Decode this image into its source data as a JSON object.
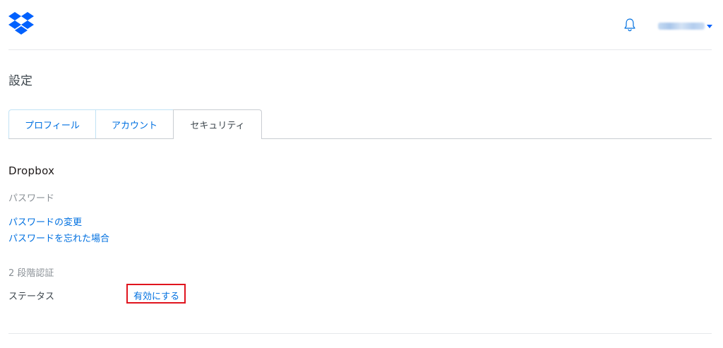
{
  "header": {
    "logo_icon": "dropbox-logo-icon",
    "notification_icon": "bell-icon",
    "user_name": "username",
    "user_menu_icon": "caret-down-icon"
  },
  "page": {
    "title": "設定"
  },
  "tabs": [
    {
      "label": "プロフィール",
      "active": false
    },
    {
      "label": "アカウント",
      "active": false
    },
    {
      "label": "セキュリティ",
      "active": true
    }
  ],
  "section": {
    "title": "Dropbox",
    "password": {
      "label": "パスワード",
      "change_link": "パスワードの変更",
      "forgot_link": "パスワードを忘れた場合"
    },
    "two_step": {
      "label": "2 段階認証",
      "status_label": "ステータス",
      "enable_link": "有効にする"
    }
  },
  "colors": {
    "accent": "#0070e0",
    "brand": "#0061fe",
    "highlight": "#e0141e",
    "divider": "#e6e8eb"
  }
}
